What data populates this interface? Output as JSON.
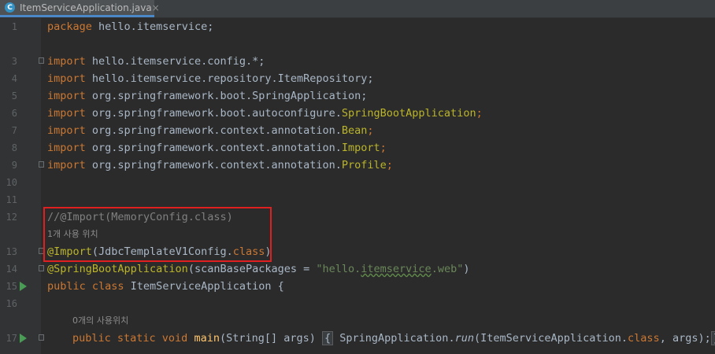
{
  "tab": {
    "icon_letter": "C",
    "filename": "ItemServiceApplication.java",
    "close": "×"
  },
  "lines": {
    "l1": {
      "num": "1",
      "kw": "package",
      "rest": " hello.itemservice;"
    },
    "l3": {
      "num": "3",
      "kw": "import",
      "rest": " hello.itemservice.config.*;"
    },
    "l4": {
      "num": "4",
      "kw": "import",
      "rest": " hello.itemservice.repository.ItemRepository;"
    },
    "l5": {
      "num": "5",
      "kw": "import",
      "rest": " org.springframework.boot.SpringApplication;"
    },
    "l6": {
      "num": "6",
      "kw": "import",
      "rest_a": " org.springframework.boot.autoconfigure.",
      "ann": "SpringBootApplication",
      "semi": ";"
    },
    "l7": {
      "num": "7",
      "kw": "import",
      "rest_a": " org.springframework.context.annotation.",
      "ann": "Bean",
      "semi": ";"
    },
    "l8": {
      "num": "8",
      "kw": "import",
      "rest_a": " org.springframework.context.annotation.",
      "ann": "Import",
      "semi": ";"
    },
    "l9": {
      "num": "9",
      "kw": "import",
      "rest_a": " org.springframework.context.annotation.",
      "ann": "Profile",
      "semi": ";"
    },
    "l10": {
      "num": "10"
    },
    "l11": {
      "num": "11"
    },
    "l12": {
      "num": "12",
      "comment": "//@Import(MemoryConfig.class)"
    },
    "hint12": "1개 사용 위치",
    "l13": {
      "num": "13",
      "ann": "@Import",
      "p1": "(JdbcTemplateV1Config.",
      "kw": "class",
      "p2": ")"
    },
    "l14": {
      "num": "14",
      "ann": "@SpringBootApplication",
      "p1": "(scanBasePackages = ",
      "str_a": "\"hello.",
      "str_b": "itemservice",
      "str_c": ".web\"",
      "p2": ")"
    },
    "l15": {
      "num": "15",
      "kw": "public class",
      "p1": " ItemServiceApplication {"
    },
    "l16": {
      "num": "16"
    },
    "hint16": "0개의 사용위치",
    "l17": {
      "num": "17",
      "kw1": "public static void",
      "fn": " main",
      "p1": "(String[] args) ",
      "b1": "{",
      "p2": " SpringApplication.",
      "run": "run",
      "p3": "(ItemServiceApplication.",
      "kw2": "class",
      "p4": ", args);",
      "b2": "}"
    }
  }
}
